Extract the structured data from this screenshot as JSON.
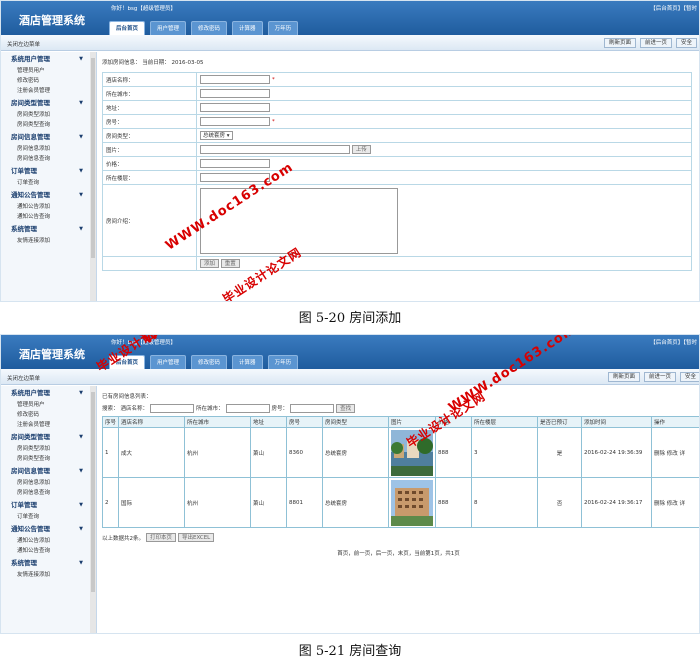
{
  "app": {
    "title": "酒店管理系统",
    "welcome": "你好！bsg【超级管理员】",
    "top_links": "【后台首页】【暂时"
  },
  "tabs": [
    "后台首页",
    "用户管理",
    "修改密码",
    "计算器",
    "万年历"
  ],
  "bar": {
    "close": "关闭左边菜单",
    "refresh": "刷新页面",
    "back": "前进一页",
    "top2_btn3": "安全"
  },
  "sidebar": [
    {
      "group": "系统用户管理",
      "items": [
        "管理员用户",
        "修改密码",
        "注册会员管理"
      ]
    },
    {
      "group": "房间类型管理",
      "items": [
        "房间类型添加",
        "房间类型查询"
      ]
    },
    {
      "group": "房间信息管理",
      "items": [
        "房间信息添加",
        "房间信息查询"
      ]
    },
    {
      "group": "订单管理",
      "items": [
        "订单查询"
      ]
    },
    {
      "group": "通知公告管理",
      "items": [
        "通知公告添加",
        "通知公告查询"
      ]
    },
    {
      "group": "系统管理",
      "items": [
        "友情连接添加"
      ]
    }
  ],
  "form": {
    "heading": "添加房间信息：",
    "date_label": "当前日期：",
    "date": "2016-03-05",
    "fields": {
      "hotel": "酒店名称：",
      "city": "所在城市：",
      "address": "地址：",
      "room_no": "房号：",
      "room_type": "房间类型：",
      "image": "图片：",
      "price": "价格：",
      "floor": "所在楼层：",
      "intro": "房间介绍："
    },
    "room_type_value": "总统套房",
    "upload": "上传",
    "add": "添加",
    "reset": "重置"
  },
  "caption1": "图 5-20 房间添加",
  "list": {
    "heading": "已有房间信息列表：",
    "search_prefix": "搜索：",
    "search_hotel": "酒店名称：",
    "search_city": "所在城市：",
    "search_room": "房号：",
    "search_btn": "查找",
    "columns": [
      "序号",
      "酒店名称",
      "所在城市",
      "地址",
      "房号",
      "房间类型",
      "图片",
      "价格",
      "所在楼层",
      "是否已预订",
      "添加时间",
      "操作"
    ],
    "rows": [
      {
        "no": "1",
        "hotel": "成大",
        "city": "杭州",
        "address": "萧山",
        "room": "8360",
        "type": "总统套房",
        "price": "888",
        "floor": "3",
        "booked": "是",
        "time": "2016-02-24 19:36:39",
        "ops": "删除 修改 详"
      },
      {
        "no": "2",
        "hotel": "国际",
        "city": "杭州",
        "address": "萧山",
        "room": "8801",
        "type": "总统套房",
        "price": "888",
        "floor": "8",
        "booked": "否",
        "time": "2016-02-24 19:36:17",
        "ops": "删除 修改 详"
      }
    ],
    "total": "以上数据共2条。",
    "print": "打印本页",
    "export": "导出EXCEL",
    "pager": "首页，前一页，后一页，末页，当前第1页，共1页"
  },
  "caption2": "图 5-21 房间查询",
  "watermarks": {
    "site": "WWW.doc163.com",
    "brand": "毕业设计论文网"
  },
  "colors": {
    "header": "#2a6aae",
    "watermark": "#d80000",
    "table_border": "#8fc1d6"
  }
}
